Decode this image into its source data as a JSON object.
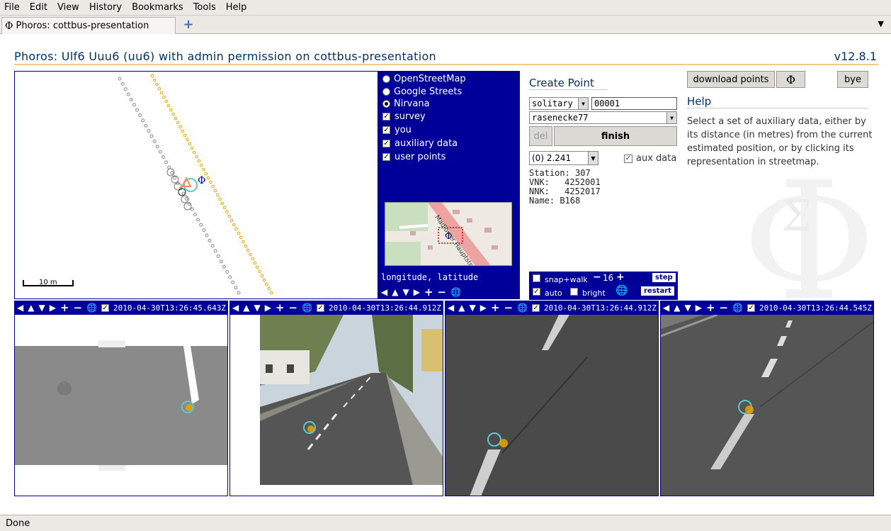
{
  "menu": [
    "File",
    "Edit",
    "View",
    "History",
    "Bookmarks",
    "Tools",
    "Help"
  ],
  "tab": {
    "title": "Phoros: cottbus-presentation"
  },
  "header": {
    "title": "Phoros: Ulf6 Uuu6 (uu6) with admin permission on cottbus-presentation",
    "version": "v12.8.1"
  },
  "map": {
    "scale_label": "10 m"
  },
  "layers": {
    "base": [
      {
        "label": "OpenStreetMap",
        "checked": false
      },
      {
        "label": "Google Streets",
        "checked": false
      },
      {
        "label": "Nirvana",
        "checked": true
      }
    ],
    "overlays": [
      {
        "label": "survey",
        "checked": true
      },
      {
        "label": "you",
        "checked": true
      },
      {
        "label": "auxiliary data",
        "checked": true
      },
      {
        "label": "user points",
        "checked": true
      }
    ],
    "minimap_street": "Madlower Hauptstr",
    "coord_label": "longitude, latitude"
  },
  "create": {
    "heading": "Create Point",
    "kind": "solitary",
    "point_id": "00001",
    "description": "rasenecke77",
    "del_label": "del",
    "finish_label": "finish",
    "aux_select": "(0) 2.241",
    "aux_label": "aux data",
    "aux_checked": true,
    "info": [
      {
        "k": "Station:",
        "v": "307"
      },
      {
        "k": "VNK:",
        "v": "4252001"
      },
      {
        "k": "NNK:",
        "v": "4252017"
      },
      {
        "k": "Name:",
        "v": "B168"
      }
    ],
    "snap_label": "snap+walk",
    "step_value": "16",
    "step_label": "step",
    "auto_label": "auto",
    "bright_label": "bright",
    "restart_label": "restart"
  },
  "right": {
    "download_label": "download points",
    "phi_label": "Φ",
    "bye_label": "bye",
    "help_heading": "Help",
    "help_text": "Select a set of auxiliary data, either by its distance (in metres) from the current estimated position, or by clicking its representation in streetmap."
  },
  "images": [
    {
      "timestamp": "2010-04-30T13:26:45.643Z"
    },
    {
      "timestamp": "2010-04-30T13:26:44.912Z"
    },
    {
      "timestamp": "2010-04-30T13:26:44.912Z"
    },
    {
      "timestamp": "2010-04-30T13:26:44.545Z"
    }
  ],
  "status": "Done",
  "colors": {
    "accent": "#000099",
    "title": "#003366",
    "aux_orange": "#e8a400",
    "cursor_cyan": "#5bc8cf"
  }
}
